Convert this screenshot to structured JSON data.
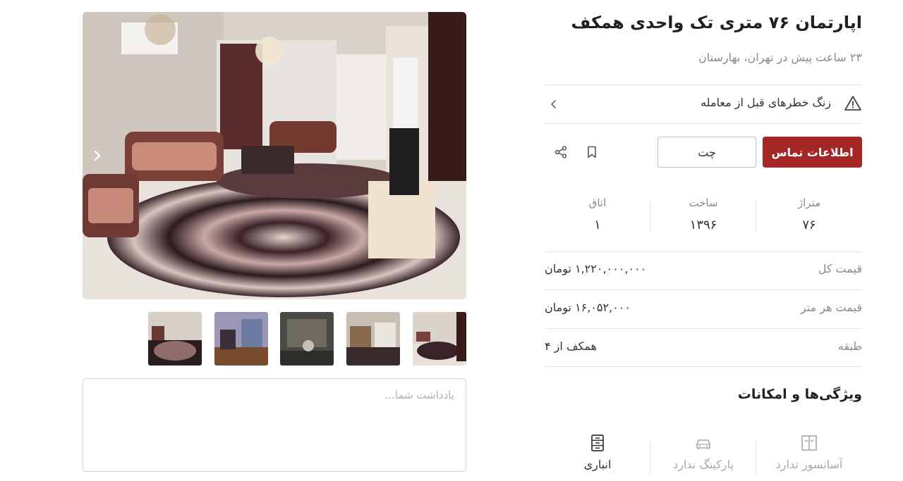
{
  "listing": {
    "title": "اپارتمان ۷۶ متری تک واحدی همکف",
    "subtitle": "۲۳ ساعت پیش در تهران، بهارستان"
  },
  "warning": {
    "text": "زنگ خطرهای قبل از معامله",
    "icon": "warning-triangle-icon"
  },
  "actions": {
    "contact_label": "اطلاعات تماس",
    "chat_label": "چت",
    "bookmark_icon": "bookmark-icon",
    "share_icon": "share-icon",
    "accent_color": "#a62626"
  },
  "stats": [
    {
      "label": "متراژ",
      "value": "۷۶"
    },
    {
      "label": "ساخت",
      "value": "۱۳۹۶"
    },
    {
      "label": "اتاق",
      "value": "۱"
    }
  ],
  "details": [
    {
      "label": "قیمت کل",
      "value": "۱,۲۲۰,۰۰۰,۰۰۰ تومان"
    },
    {
      "label": "قیمت هر متر",
      "value": "۱۶,۰۵۲,۰۰۰ تومان"
    },
    {
      "label": "طبقه",
      "value": "همکف از ۴"
    }
  ],
  "features": {
    "title": "ویژگی‌ها و امکانات",
    "items": [
      {
        "label": "آسانسور ندارد",
        "icon": "elevator-icon",
        "available": false
      },
      {
        "label": "پارکینگ ندارد",
        "icon": "car-icon",
        "available": false
      },
      {
        "label": "انباری",
        "icon": "storage-icon",
        "available": true
      }
    ]
  },
  "gallery": {
    "thumbnail_count": 5
  },
  "note": {
    "placeholder": "یادداشت شما..."
  }
}
